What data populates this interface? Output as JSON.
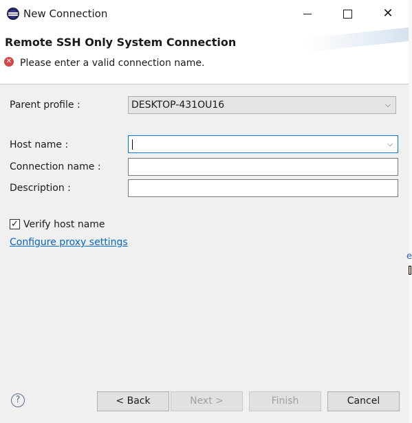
{
  "window": {
    "title": "New Connection",
    "controls": {
      "minimize": "minimize-icon",
      "maximize": "maximize-icon",
      "close": "close-icon"
    }
  },
  "banner": {
    "title": "Remote SSH Only System Connection",
    "error_message": "Please enter a valid connection name."
  },
  "form": {
    "parent_profile_label": "Parent profile :",
    "parent_profile_value": "DESKTOP-431OU16",
    "host_name_label": "Host name :",
    "host_name_value": "",
    "connection_name_label": "Connection name :",
    "connection_name_value": "",
    "description_label": "Description :",
    "description_value": "",
    "verify_host_label": "Verify host name",
    "verify_host_checked": true,
    "proxy_link": "Configure proxy settings"
  },
  "buttons": {
    "back": "< Back",
    "next": "Next >",
    "finish": "Finish",
    "cancel": "Cancel"
  },
  "side": {
    "glyph": "e"
  }
}
